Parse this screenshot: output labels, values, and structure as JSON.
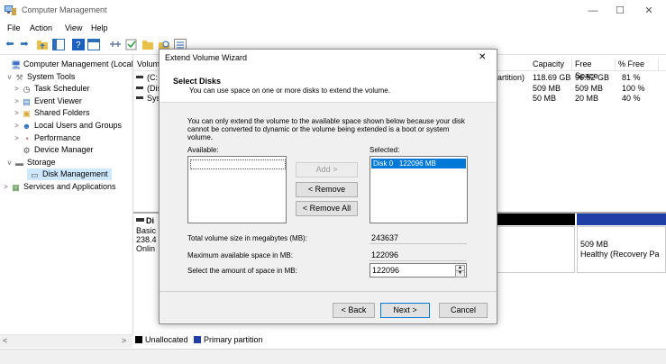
{
  "window": {
    "title": "Computer Management",
    "minimize": "—",
    "maximize": "☐",
    "close": "✕"
  },
  "menu": [
    "File",
    "Action",
    "View",
    "Help"
  ],
  "tree": [
    {
      "label": "Computer Management (Local",
      "expander": "",
      "icon": "computer-icon"
    },
    {
      "label": "System Tools",
      "expander": "v",
      "icon": "tools-icon"
    },
    {
      "label": "Task Scheduler",
      "expander": ">",
      "icon": "clock-icon"
    },
    {
      "label": "Event Viewer",
      "expander": ">",
      "icon": "event-viewer-icon"
    },
    {
      "label": "Shared Folders",
      "expander": ">",
      "icon": "shared-folder-icon"
    },
    {
      "label": "Local Users and Groups",
      "expander": ">",
      "icon": "users-icon"
    },
    {
      "label": "Performance",
      "expander": ">",
      "icon": "performance-icon"
    },
    {
      "label": "Device Manager",
      "expander": "",
      "icon": "device-manager-icon"
    },
    {
      "label": "Storage",
      "expander": "v",
      "icon": "storage-icon"
    },
    {
      "label": "Disk Management",
      "expander": "",
      "icon": "disk-icon",
      "selected": true
    },
    {
      "label": "Services and Applications",
      "expander": ">",
      "icon": "services-icon"
    }
  ],
  "volumes": {
    "header_volume": "Volum",
    "columns": [
      "Capacity",
      "Free Space",
      "% Free"
    ],
    "rows": [
      {
        "name": "(C:",
        "type": "Partition)",
        "capacity": "118.69 GB",
        "free": "96.52 GB",
        "pct": "81 %"
      },
      {
        "name": "(Dis",
        "type": "",
        "capacity": "509 MB",
        "free": "509 MB",
        "pct": "100 %"
      },
      {
        "name": "Sys",
        "type": "",
        "capacity": "50 MB",
        "free": "20 MB",
        "pct": "40 %"
      }
    ]
  },
  "disk0": {
    "label": "Di",
    "type": "Basic",
    "size": "238.4",
    "status": "Onlin"
  },
  "recovery": {
    "size": "509 MB",
    "status": "Healthy (Recovery Pa"
  },
  "legend": {
    "unallocated": "Unallocated",
    "primary": "Primary partition"
  },
  "colors": {
    "unallocated": "#000000",
    "primary": "#1f3fa6",
    "selection": "#0078d7",
    "tree_selection": "#cde8ff"
  },
  "dialog": {
    "title": "Extend Volume Wizard",
    "close": "✕",
    "heading": "Select Disks",
    "subheading": "You can use space on one or more disks to extend the volume.",
    "info": "You can only extend the volume to the available space shown below because your disk cannot be converted to dynamic or the volume being extended is a boot or system volume.",
    "available_label": "Available:",
    "selected_label": "Selected:",
    "available_items": [],
    "selected_items": [
      {
        "disk": "Disk 0",
        "size": "122096 MB"
      }
    ],
    "add_button": "Add >",
    "remove_button": "< Remove",
    "remove_all_button": "< Remove All",
    "total_label": "Total volume size in megabytes (MB):",
    "total_value": "243637",
    "max_label": "Maximum available space in MB:",
    "max_value": "122096",
    "amount_label": "Select the amount of space in MB:",
    "amount_value": "122096",
    "back_button": "< Back",
    "next_button": "Next >",
    "cancel_button": "Cancel"
  }
}
